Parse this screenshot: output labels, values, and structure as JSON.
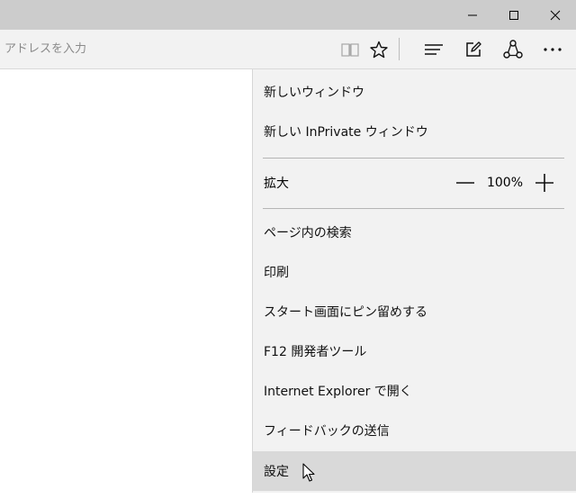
{
  "address": {
    "placeholder": "アドレスを入力"
  },
  "window_controls": [
    "minimize",
    "maximize",
    "close"
  ],
  "toolbar_icons": [
    "reading-view-icon",
    "favorites-star-icon",
    "hub-icon",
    "web-note-icon",
    "share-icon",
    "more-icon"
  ],
  "menu": {
    "new_window": "新しいウィンドウ",
    "new_inprivate": "新しい InPrivate ウィンドウ",
    "zoom_label": "拡大",
    "zoom_value": "100%",
    "find": "ページ内の検索",
    "print": "印刷",
    "pin_start": "スタート画面にピン留めする",
    "f12": "F12 開発者ツール",
    "open_ie": "Internet Explorer で開く",
    "feedback": "フィードバックの送信",
    "settings": "設定"
  },
  "colors": {
    "titlebar": "#cccccc",
    "menu_bg": "#f2f2f2",
    "hover": "#d9d9d9"
  }
}
